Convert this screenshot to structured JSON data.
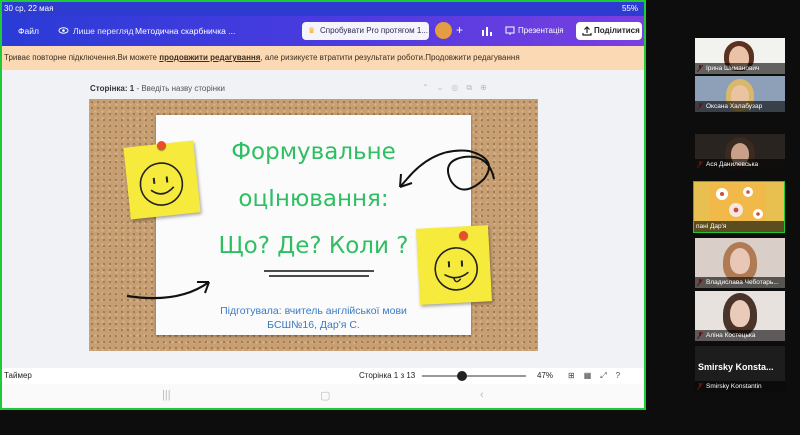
{
  "status_bar": {
    "left": "30 ср, 22 мая",
    "right": "55%"
  },
  "top_bar": {
    "file": "Файл",
    "view_only": "Лише перегляд",
    "title": "Методична скарбничка ...",
    "pro_button": "Спробувати Pro протягом 1...",
    "present_button": "Презентація",
    "share_button": "Поділитися"
  },
  "notice": {
    "before": "Триває повторне підключення.Ви можете ",
    "link": "продовжити редагування",
    "after": ", але ризикуєте втратити результати роботи.Продовжити редагування"
  },
  "page_header": {
    "label": "Сторінка: 1",
    "placeholder": " - Введіть назву сторінки"
  },
  "slide": {
    "title1": "Формувальне",
    "title2": "оцІнювання:",
    "title3": "Що? Де? Коли ?",
    "subtitle1": "Підготувала: вчитель англійської мови",
    "subtitle2": "БСШ№16,  Дар'я  С."
  },
  "footer": {
    "timer": "Таймер",
    "pages": "Сторінка 1 з 13",
    "zoom": "47%",
    "zoom_fraction": 0.47
  },
  "participants": [
    {
      "name": "Ірина Шиманович"
    },
    {
      "name": "Оксана Халабузар"
    },
    {
      "name": "Ася Данилевська"
    },
    {
      "name": "пані Дар'я"
    },
    {
      "name": "Владислава Чеботарь..."
    },
    {
      "name": "Аліна Костецька"
    },
    {
      "name": "Smirsky Konstantin",
      "big": "Smirsky  Konsta..."
    }
  ],
  "colors": {
    "speaker_border": "#1ecb37",
    "topbar": "#3f3bdc",
    "notice": "#fbd9b4",
    "slide_text": "#2fbf63",
    "subtitle_text": "#3b7ac4"
  }
}
